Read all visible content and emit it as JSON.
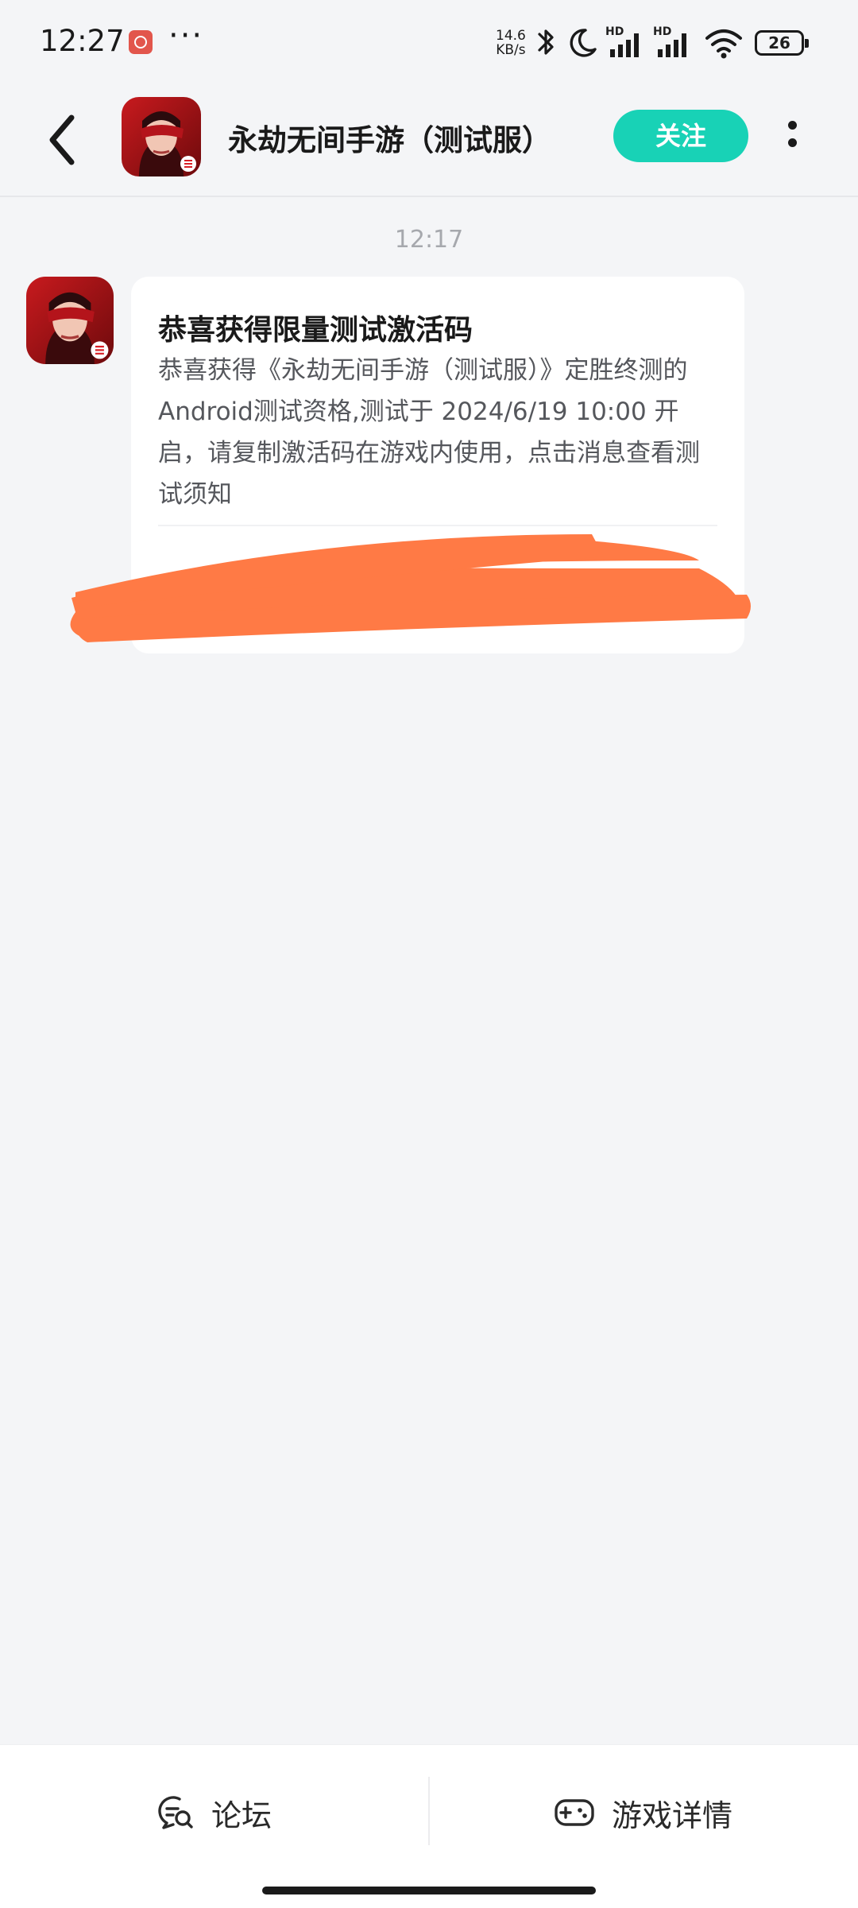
{
  "status_bar": {
    "time": "12:27",
    "speed_value": "14.6",
    "speed_unit": "KB/s",
    "network_label_1": "HD",
    "network_label_2": "HD",
    "battery": "26"
  },
  "header": {
    "title": "永劫无间手游（测试服）",
    "follow_label": "关注"
  },
  "conversation": {
    "timestamp": "12:17",
    "message": {
      "title": "恭喜获得限量测试激活码",
      "body": "恭喜获得《永劫无间手游（测试服）》定胜终测的Android测试资格,测试于 2024/6/19 10:00 开启，请复制激活码在游戏内使用，点击消息查看测试须知"
    }
  },
  "bottom_bar": {
    "forum_label": "论坛",
    "game_detail_label": "游戏详情"
  },
  "colors": {
    "accent": "#18d2b6",
    "background": "#f4f5f7",
    "redaction": "#ff7a45"
  },
  "icons": {
    "back": "chevron-left-icon",
    "more": "more-vertical-icon",
    "forum": "forum-chat-icon",
    "game": "gamepad-icon"
  }
}
